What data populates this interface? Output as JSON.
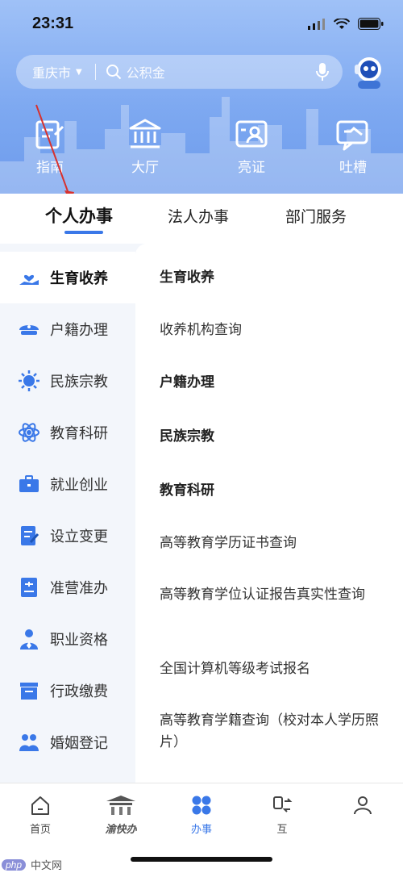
{
  "status": {
    "time": "23:31"
  },
  "search": {
    "city": "重庆市",
    "placeholder": "公积金"
  },
  "quick_actions": [
    {
      "label": "指南",
      "icon": "guide-doc-icon"
    },
    {
      "label": "大厅",
      "icon": "hall-building-icon"
    },
    {
      "label": "亮证",
      "icon": "id-card-icon"
    },
    {
      "label": "吐槽",
      "icon": "feedback-chat-icon"
    }
  ],
  "tabs": [
    {
      "label": "个人办事",
      "active": true
    },
    {
      "label": "法人办事",
      "active": false
    },
    {
      "label": "部门服务",
      "active": false
    }
  ],
  "sidebar": {
    "items": [
      {
        "label": "生育收养",
        "icon": "hand-heart-icon",
        "active": true
      },
      {
        "label": "户籍办理",
        "icon": "police-cap-icon",
        "active": false
      },
      {
        "label": "民族宗教",
        "icon": "sun-emblem-icon",
        "active": false
      },
      {
        "label": "教育科研",
        "icon": "atom-icon",
        "active": false
      },
      {
        "label": "就业创业",
        "icon": "briefcase-icon",
        "active": false
      },
      {
        "label": "设立变更",
        "icon": "document-edit-icon",
        "active": false
      },
      {
        "label": "准营准办",
        "icon": "license-icon",
        "active": false
      },
      {
        "label": "职业资格",
        "icon": "worker-icon",
        "active": false
      },
      {
        "label": "行政缴费",
        "icon": "payment-box-icon",
        "active": false
      },
      {
        "label": "婚姻登记",
        "icon": "couple-icon",
        "active": false
      }
    ]
  },
  "panel": {
    "items": [
      {
        "text": "生育收养",
        "type": "heading"
      },
      {
        "text": "收养机构查询",
        "type": "link"
      },
      {
        "text": "户籍办理",
        "type": "heading"
      },
      {
        "text": "民族宗教",
        "type": "heading"
      },
      {
        "text": "教育科研",
        "type": "heading"
      },
      {
        "text": "高等教育学历证书查询",
        "type": "link"
      },
      {
        "text": "高等教育学位认证报告真实性查询",
        "type": "link"
      },
      {
        "text": "全国计算机等级考试报名",
        "type": "link"
      },
      {
        "text": "高等教育学籍查询（校对本人学历照片）",
        "type": "link"
      }
    ]
  },
  "bottom_nav": [
    {
      "label": "首页",
      "icon": "home-icon",
      "active": false
    },
    {
      "label": "渝快办",
      "icon": "yukuaiban-logo-icon",
      "active": false
    },
    {
      "label": "办事",
      "icon": "four-petal-icon",
      "active": true
    },
    {
      "label": "互",
      "icon": "exchange-icon",
      "active": false
    },
    {
      "label": "",
      "icon": "person-icon",
      "active": false
    }
  ],
  "watermark": {
    "badge": "php",
    "text": "中文网"
  },
  "colors": {
    "accent": "#3a78e8",
    "hero": "#7ea9f1",
    "sidebar_bg": "#f3f6fb"
  }
}
